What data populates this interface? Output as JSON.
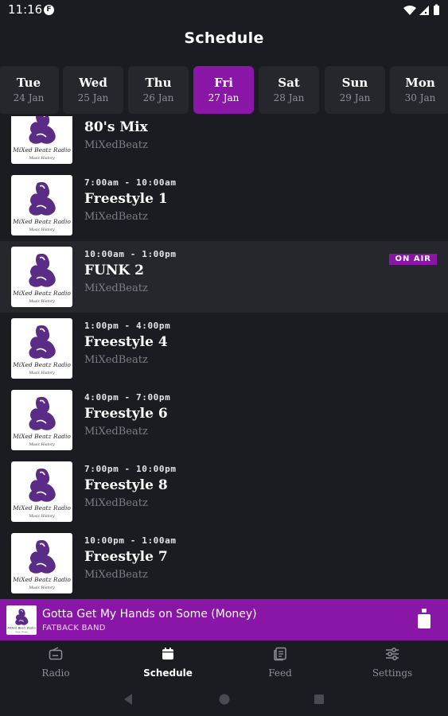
{
  "status_bar": {
    "time": "11:16",
    "app_badge": "F"
  },
  "header": {
    "title": "Schedule"
  },
  "days": [
    {
      "name": "Tue",
      "date": "24 Jan"
    },
    {
      "name": "Wed",
      "date": "25 Jan"
    },
    {
      "name": "Thu",
      "date": "26 Jan"
    },
    {
      "name": "Fri",
      "date": "27 Jan",
      "selected": true
    },
    {
      "name": "Sat",
      "date": "28 Jan"
    },
    {
      "name": "Sun",
      "date": "29 Jan"
    },
    {
      "name": "Mon",
      "date": "30 Jan"
    }
  ],
  "shows": [
    {
      "time": "",
      "title": "80's Mix",
      "host": "MiXedBeatz"
    },
    {
      "time": "7:00am - 10:00am",
      "title": "Freestyle 1",
      "host": "MiXedBeatz"
    },
    {
      "time": "10:00am - 1:00pm",
      "title": "FUNK 2",
      "host": "MiXedBeatz",
      "badge": "ON AIR"
    },
    {
      "time": "1:00pm - 4:00pm",
      "title": "Freestyle 4",
      "host": "MiXedBeatz"
    },
    {
      "time": "4:00pm - 7:00pm",
      "title": "Freestyle 6",
      "host": "MiXedBeatz"
    },
    {
      "time": "7:00pm - 10:00pm",
      "title": "Freestyle 8",
      "host": "MiXedBeatz"
    },
    {
      "time": "10:00pm - 1:00am",
      "title": "Freestyle 7",
      "host": "MiXedBeatz"
    }
  ],
  "player": {
    "title": "Gotta Get My Hands on Some (Money)",
    "artist": "FATBACK BAND"
  },
  "tabs": [
    {
      "label": "Radio",
      "icon": "radio-icon"
    },
    {
      "label": "Schedule",
      "icon": "calendar-icon",
      "active": true
    },
    {
      "label": "Feed",
      "icon": "feed-icon"
    },
    {
      "label": "Settings",
      "icon": "sliders-icon"
    }
  ],
  "logo_text": "MiXed Beatz Radio",
  "logo_subtext": "Music History",
  "colors": {
    "accent": "#8a16a8",
    "background": "#1b1c21",
    "card": "#26272d",
    "muted": "#7d7e85"
  }
}
